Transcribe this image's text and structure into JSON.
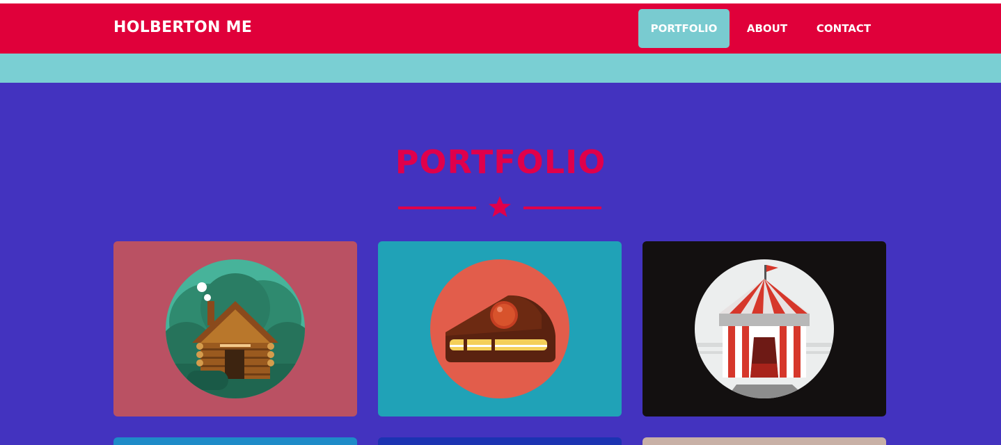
{
  "header": {
    "brand": "HOLBERTON ME",
    "nav": [
      {
        "label": "PORTFOLIO",
        "active": true
      },
      {
        "label": "ABOUT",
        "active": false
      },
      {
        "label": "CONTACT",
        "active": false
      }
    ]
  },
  "portfolio": {
    "title": "PORTFOLIO",
    "divider_icon": "star-icon",
    "items": [
      {
        "icon": "cabin-icon",
        "color": "#ba5163"
      },
      {
        "icon": "cake-icon",
        "color": "#20a2b7"
      },
      {
        "icon": "circus-tent-icon",
        "color": "#131010"
      },
      {
        "icon": "",
        "color": "#1e8bc8"
      },
      {
        "icon": "",
        "color": "#1c33b2"
      },
      {
        "icon": "",
        "color": "#c8b0a6"
      }
    ]
  },
  "colors": {
    "navbar": "#e0003a",
    "accent": "#79cbd0",
    "background": "#4333bf",
    "title": "#e0004b"
  }
}
